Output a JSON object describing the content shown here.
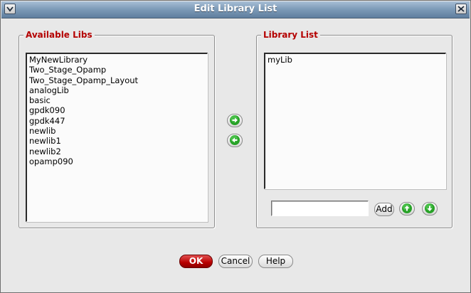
{
  "window": {
    "title": "Edit Library List"
  },
  "available": {
    "label": "Available Libs",
    "items": [
      "MyNewLibrary",
      "Two_Stage_Opamp",
      "Two_Stage_Opamp_Layout",
      "analogLib",
      "basic",
      "gpdk090",
      "gpdk447",
      "newlib",
      "newlib1",
      "newlib2",
      "opamp090"
    ]
  },
  "library_list": {
    "label": "Library List",
    "items": [
      "myLib"
    ],
    "input_value": "",
    "add_label": "Add"
  },
  "icons": {
    "window_menu": "chevron-down-icon",
    "close": "close-icon",
    "move_right": "arrow-right-icon",
    "move_left": "arrow-left-icon",
    "move_up": "arrow-up-icon",
    "move_down": "arrow-down-icon"
  },
  "footer": {
    "ok_label": "OK",
    "cancel_label": "Cancel",
    "help_label": "Help"
  },
  "colors": {
    "legend": "#b40000",
    "ok_button": "#b80000",
    "arrow_buttons": "#28a228"
  }
}
